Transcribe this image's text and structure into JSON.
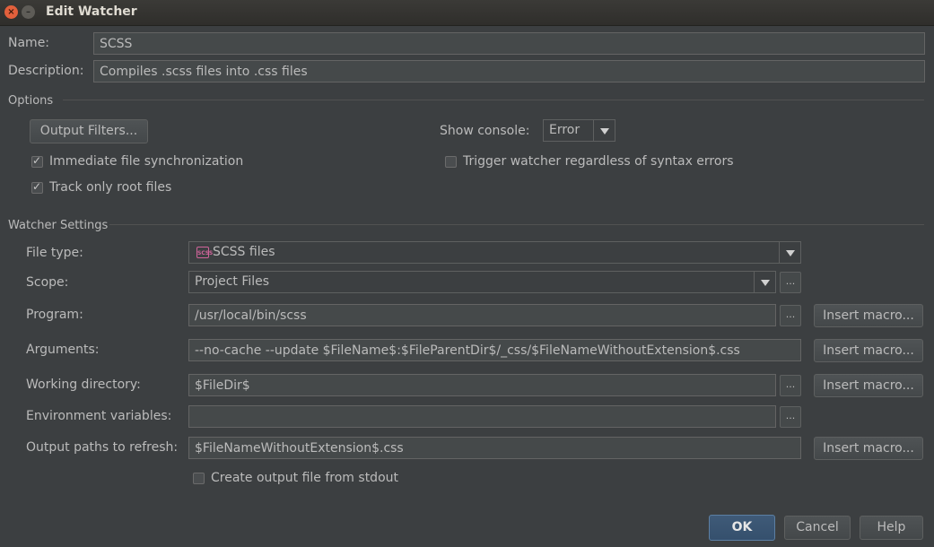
{
  "window": {
    "title": "Edit Watcher",
    "close_glyph": "×",
    "min_glyph": "–"
  },
  "name": {
    "label": "Name:",
    "value": "SCSS"
  },
  "description": {
    "label": "Description:",
    "value": "Compiles .scss files into .css files"
  },
  "options": {
    "section_title": "Options",
    "output_filters_label": "Output Filters...",
    "show_console_label": "Show console:",
    "show_console_value": "Error",
    "immediate_sync_label": "Immediate file synchronization",
    "immediate_sync_checked": true,
    "track_root_label": "Track only root files",
    "track_root_checked": true,
    "trigger_label": "Trigger watcher regardless of syntax errors",
    "trigger_checked": false
  },
  "watcher": {
    "section_title": "Watcher Settings",
    "file_type_label": "File type:",
    "file_type_value": "SCSS files",
    "file_type_icon": "scss-file-icon",
    "file_type_icon_text": "SCSS",
    "scope_label": "Scope:",
    "scope_value": "Project Files",
    "program_label": "Program:",
    "program_value": "/usr/local/bin/scss",
    "arguments_label": "Arguments:",
    "arguments_value": "--no-cache --update $FileName$:$FileParentDir$/_css/$FileNameWithoutExtension$.css",
    "working_dir_label": "Working directory:",
    "working_dir_value": "$FileDir$",
    "env_vars_label": "Environment variables:",
    "env_vars_value": "",
    "output_paths_label": "Output paths to refresh:",
    "output_paths_value": "$FileNameWithoutExtension$.css",
    "insert_macro_label": "Insert macro...",
    "browse_label": "...",
    "create_output_label": "Create output file from stdout",
    "create_output_checked": false
  },
  "footer": {
    "ok_label": "OK",
    "cancel_label": "Cancel",
    "help_label": "Help"
  },
  "colors": {
    "background": "#3c3f41",
    "field_bg": "#45494a",
    "text": "#bbbbbb",
    "accent": "#35506d"
  }
}
